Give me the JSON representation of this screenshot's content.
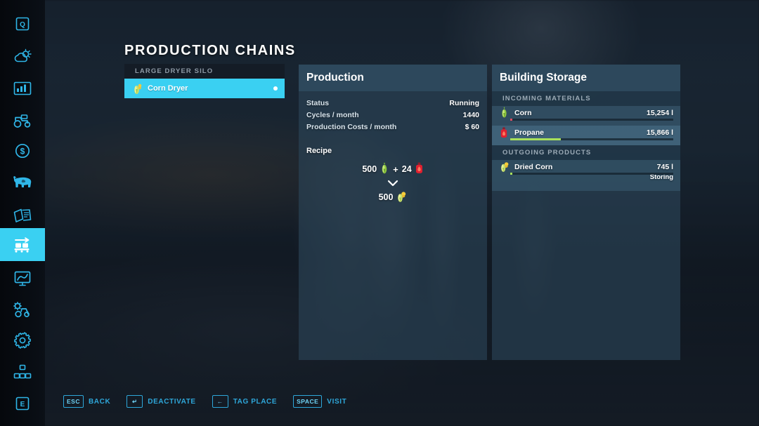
{
  "page": {
    "title": "PRODUCTION CHAINS"
  },
  "sidebar": {
    "items": [
      {
        "name": "quests-icon",
        "label": "Q",
        "active": false
      },
      {
        "name": "weather-icon",
        "label": "Weather",
        "active": false
      },
      {
        "name": "statistics-icon",
        "label": "Statistics",
        "active": false
      },
      {
        "name": "vehicles-icon",
        "label": "Vehicles",
        "active": false
      },
      {
        "name": "finances-icon",
        "label": "Finances",
        "active": false
      },
      {
        "name": "animals-icon",
        "label": "Animals",
        "active": false
      },
      {
        "name": "contracts-icon",
        "label": "Contracts",
        "active": false
      },
      {
        "name": "production-icon",
        "label": "Production Chains",
        "active": true
      },
      {
        "name": "map-overview-icon",
        "label": "Map Overview",
        "active": false
      },
      {
        "name": "vehicle-config-icon",
        "label": "Configuration",
        "active": false
      },
      {
        "name": "settings-icon",
        "label": "Settings",
        "active": false
      },
      {
        "name": "multiplayer-icon",
        "label": "Multiplayer",
        "active": false
      },
      {
        "name": "exit-icon",
        "label": "E",
        "active": false
      }
    ]
  },
  "chain_list": {
    "group_header": "LARGE DRYER SILO",
    "rows": [
      {
        "label": "Corn Dryer",
        "icon": "dried-corn-icon",
        "selected": true,
        "status_dot": "#ffffff"
      }
    ]
  },
  "production": {
    "header": "Production",
    "stats": [
      {
        "label": "Status",
        "value": "Running"
      },
      {
        "label": "Cycles / month",
        "value": "1440"
      },
      {
        "label": "Production Costs / month",
        "value": "$ 60"
      }
    ],
    "recipe": {
      "title": "Recipe",
      "plus": "+",
      "inputs": [
        {
          "amount": "500",
          "icon": "corn-icon"
        },
        {
          "amount": "24",
          "icon": "propane-icon"
        }
      ],
      "outputs": [
        {
          "amount": "500",
          "icon": "dried-corn-icon"
        }
      ]
    }
  },
  "storage": {
    "header": "Building Storage",
    "sections": [
      {
        "title": "INCOMING MATERIALS",
        "rows": [
          {
            "name": "Corn",
            "icon": "corn-icon",
            "amount": "15,254 l",
            "fill_pct": 1.2,
            "fill_color": "#e04c63",
            "status": "",
            "highlight": false
          },
          {
            "name": "Propane",
            "icon": "propane-icon",
            "amount": "15,866 l",
            "fill_pct": 31,
            "fill_color": "#a8e05a",
            "status": "",
            "highlight": true
          }
        ]
      },
      {
        "title": "OUTGOING PRODUCTS",
        "rows": [
          {
            "name": "Dried Corn",
            "icon": "dried-corn-icon",
            "amount": "745 l",
            "fill_pct": 1.5,
            "fill_color": "#a8e05a",
            "status": "Storing",
            "highlight": false
          }
        ]
      }
    ]
  },
  "hotkeys": [
    {
      "key": "ESC",
      "label": "BACK",
      "icon": "esc-key-icon"
    },
    {
      "key": "↵",
      "label": "DEACTIVATE",
      "icon": "enter-key-icon"
    },
    {
      "key": "←",
      "label": "TAG PLACE",
      "icon": "left-arrow-key-icon"
    },
    {
      "key": "SPACE",
      "label": "VISIT",
      "icon": "space-key-icon"
    }
  ],
  "colors": {
    "accent": "#3ad0f2",
    "panel_header": "#2d485c",
    "panel_body": "#2c4658",
    "bar_green": "#a8e05a",
    "bar_red": "#e04c63",
    "hotkey_blue": "#2ea7da"
  }
}
